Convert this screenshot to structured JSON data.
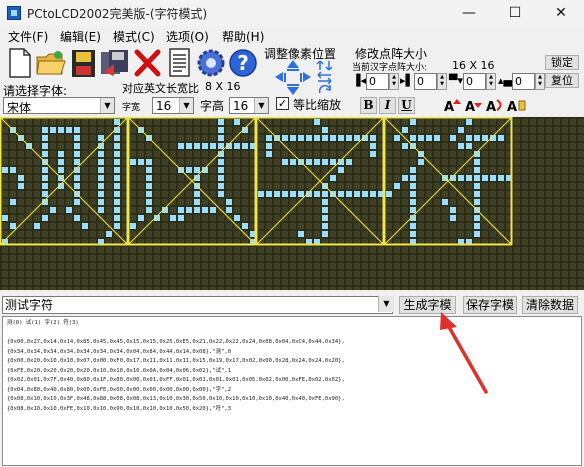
{
  "window": {
    "title": "PCtoLCD2002完美版-(字符模式)",
    "minimize": "—",
    "maximize": "☐",
    "close": "✕"
  },
  "menu": [
    "文件(F)",
    "编辑(E)",
    "模式(C)",
    "选项(O)",
    "帮助(H)"
  ],
  "toolbar": {
    "icons": [
      "new-file-icon",
      "open-folder-icon",
      "save-disk-icon",
      "save-as-icon",
      "delete-icon",
      "document-icon",
      "settings-gear-icon",
      "help-icon"
    ]
  },
  "pixel_adjust": {
    "label": "调整像素位置"
  },
  "dot_matrix": {
    "label": "修改点阵大小",
    "current_size_label": "当前汉字点阵大小:",
    "current_size": "16 X 16",
    "lock": "锁定",
    "reset": "复位",
    "spinners": [
      "0",
      "0",
      "0",
      "0"
    ]
  },
  "font": {
    "select_label": "请选择字体:",
    "english_width_label": "对应英文长宽比",
    "english_width_value": "8 X 16",
    "family": "宋体",
    "width_label": "字宽",
    "width": "16",
    "height_label": "字高",
    "height": "16",
    "proportional_label": "等比缩放",
    "proportional_checked": "✓",
    "bold": "B",
    "italic": "I",
    "underline": "U"
  },
  "lcd": {
    "glyph_count": 4,
    "grid_size": 16,
    "colors": {
      "background": "#2e2f17",
      "pixel_on": "#9bdcff",
      "pixel_off": "#404126",
      "guide": "#f1e64a"
    }
  },
  "input": {
    "text": "测试字符",
    "generate": "生成字模",
    "save": "保存字模",
    "clear": "清除数据"
  },
  "output": {
    "header": "测(0) 试(1) 字(2) 符(3)",
    "lines": [
      "{0x00,0x27,0x14,0x14,0x85,0x45,0x45,0x15,0x15,0x25,0xE5,0x21,0x22,0x22,0x24,0x08,0x04,0xC4,0x44,0x34},",
      "{0x34,0x34,0x34,0x34,0x34,0x34,0x34,0x04,0x84,0x44,0x14,0x08},\"测\",0",
      "{0x00,0x20,0x10,0x10,0x07,0x00,0xF0,0x17,0x11,0x11,0x11,0x15,0x19,0x17,0x02,0x00,0x28,0x24,0x24,0x20},",
      "{0xFE,0x20,0x20,0x20,0x20,0x10,0x10,0x10,0x0A,0x04,0x06,0x02},\"试\",1",
      "{0x02,0x01,0x7F,0x40,0x80,0x1F,0x00,0x00,0x01,0xFF,0x01,0x01,0x01,0x01,0x05,0x02,0x00,0xFE,0x02,0x02},",
      "{0x04,0x80,0x40,0x80,0x00,0xFE,0x00,0x00,0x00,0x00,0x00,0x00},\"字\",2",
      "{0x08,0x10,0x10,0x3F,0x48,0x88,0x08,0x08,0x13,0x10,0x30,0x50,0x10,0x10,0x10,0x10,0x40,0x40,0xFE,0x90},",
      "{0x08,0x10,0x10,0xFE,0x10,0x10,0x90,0x10,0x10,0x10,0x50,0x20},\"符\",3"
    ]
  }
}
